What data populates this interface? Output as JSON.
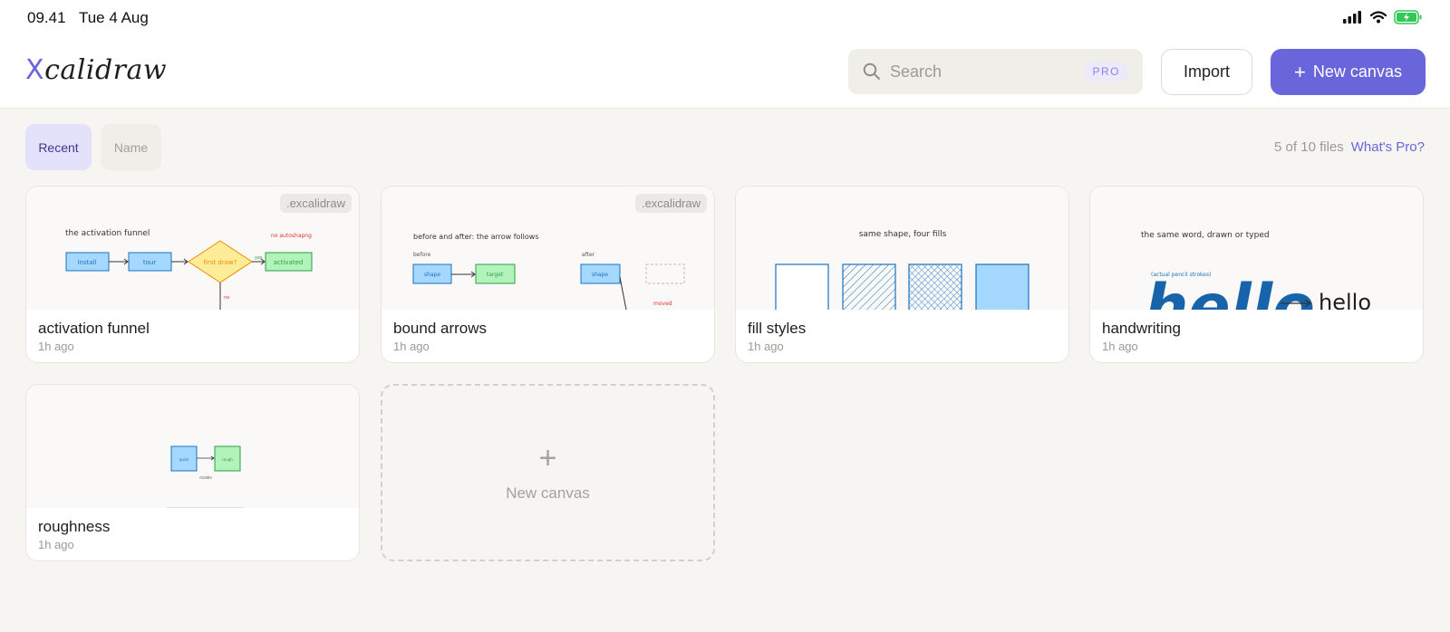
{
  "status_bar": {
    "time": "09.41",
    "date": "Tue 4 Aug",
    "icons": [
      "cellular-signal-icon",
      "wifi-icon",
      "battery-charging-icon"
    ]
  },
  "header": {
    "logo_x": "X",
    "logo_rest": "calidraw",
    "search": {
      "placeholder": "Search",
      "badge": "PRO"
    },
    "import_label": "Import",
    "new_canvas_label": "New canvas"
  },
  "toolbar": {
    "sort_recent": "Recent",
    "sort_name": "Name",
    "files_count": "5 of 10 files",
    "whats_pro": "What's Pro?"
  },
  "colors": {
    "accent": "#6965db",
    "accent_soft": "#e4e1fb",
    "background": "#f6f5f2"
  },
  "cards": [
    {
      "title": "activation funnel",
      "time": "1h ago",
      "badge": ".excalidraw",
      "thumb": {
        "heading": "the activation funnel",
        "n1": "install",
        "n2": "tour",
        "n3": "first draw?",
        "n4": "activated",
        "note": "no autoshapng",
        "yes": "yes",
        "no": "no"
      }
    },
    {
      "title": "bound arrows",
      "time": "1h ago",
      "badge": ".excalidraw",
      "thumb": {
        "heading": "before and after: the arrow follows",
        "before": "before",
        "after": "after",
        "n1": "shape",
        "n2": "target",
        "n3": "shape",
        "moved": "moved"
      }
    },
    {
      "title": "fill styles",
      "time": "1h ago",
      "thumb": {
        "heading": "same shape, four fills"
      }
    },
    {
      "title": "handwriting",
      "time": "1h ago",
      "thumb": {
        "heading": "the same word, drawn or typed",
        "sub": "(actual pencil strokes)",
        "drawn": "hello",
        "typed": "hello"
      }
    },
    {
      "title": "roughness",
      "time": "1h ago",
      "thumb": {
        "n1": "quiet",
        "n2": "rough",
        "caption": "middle"
      }
    }
  ],
  "new_card": {
    "label": "New canvas"
  }
}
